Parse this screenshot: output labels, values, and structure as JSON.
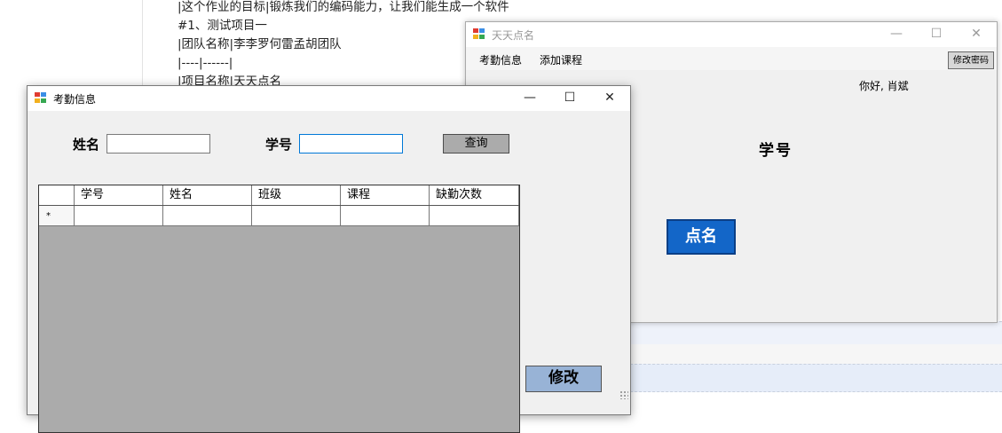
{
  "background_editor": {
    "lines": [
      "|这个作业的目标|锻炼我们的编码能力，让我们能生成一个软件",
      "#1、测试项目一",
      "|团队名称|李李罗何雷孟胡团队",
      "|----|------|",
      "|项目名称|天天点名"
    ]
  },
  "main_window": {
    "title": "天天点名",
    "controls": {
      "minimize": "—",
      "maximize": "☐",
      "close": "✕"
    },
    "menu": [
      "考勤信息",
      "添加课程"
    ],
    "change_password_button": "修改密码",
    "greeting": "你好, 肖斌",
    "student_id_label": "学号",
    "rollcall_button": "点名"
  },
  "attendance_window": {
    "title": "考勤信息",
    "controls": {
      "minimize": "—",
      "maximize": "☐",
      "close": "✕"
    },
    "name_label": "姓名",
    "name_value": "",
    "student_id_label": "学号",
    "student_id_value": "",
    "query_button": "查询",
    "grid": {
      "columns": [
        "学号",
        "姓名",
        "班级",
        "课程",
        "缺勤次数"
      ],
      "new_row_marker": "*"
    },
    "modify_button": "修改"
  },
  "colors": {
    "rollcall_button": "#1366c8",
    "modify_button": "#98b3d6",
    "grid_background": "#ababab",
    "window_background": "#f0f0f0"
  }
}
